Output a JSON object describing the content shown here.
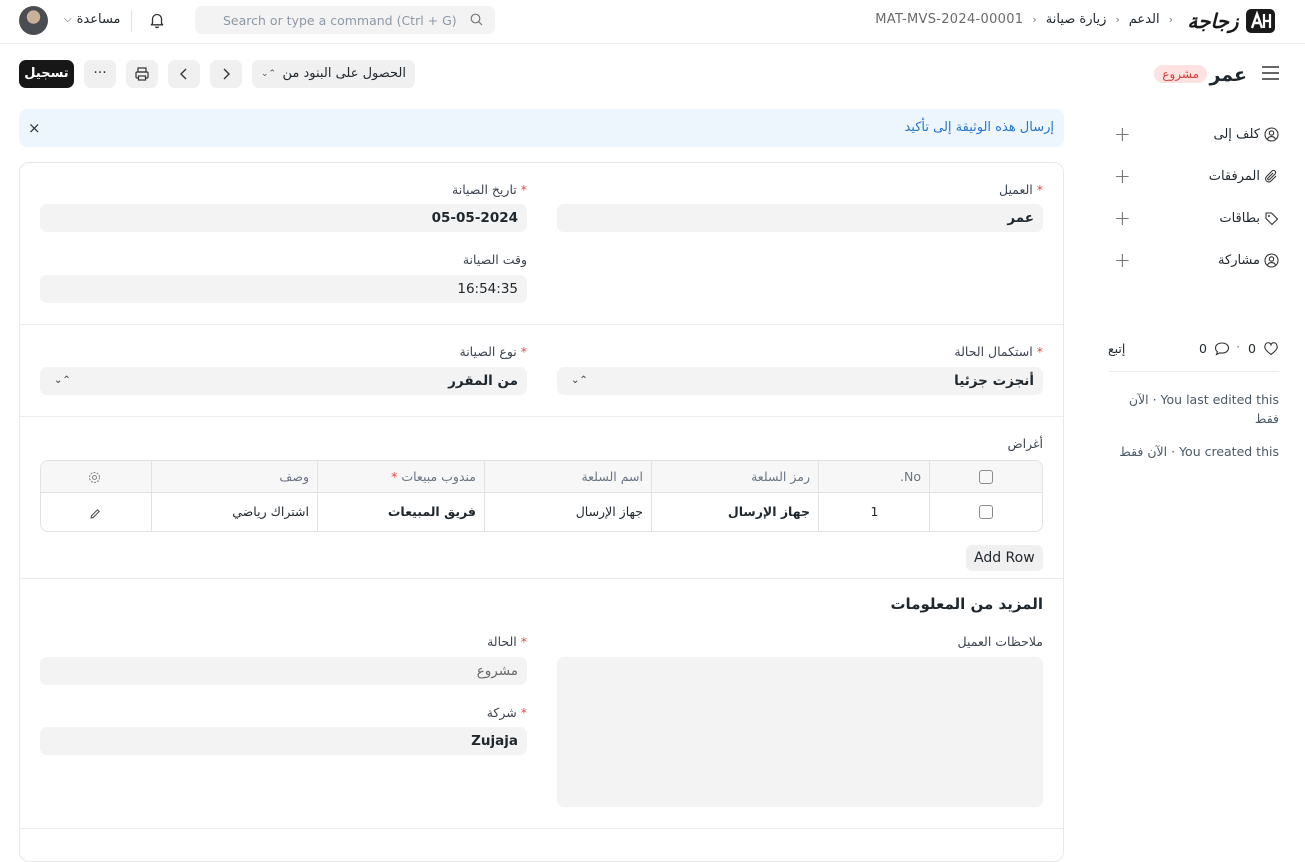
{
  "topbar": {
    "help_label": "مساعدة",
    "search_placeholder": "Search or type a command (Ctrl + G)",
    "breadcrumbs": [
      "الدعم",
      "زيارة صيانة",
      "MAT-MVS-2024-00001"
    ],
    "logo_text": "زجاجة"
  },
  "header": {
    "title": "عمر",
    "status_badge": "مشروع",
    "submit_label": "تسجيل",
    "more_label": "···",
    "get_items_label": "الحصول على البنود من"
  },
  "alert": {
    "message": "إرسال هذه الوثيقة إلى تأكيد",
    "close": "×"
  },
  "sidebar": {
    "items": [
      {
        "label": "كلف إلى",
        "icon": "assign-user-icon"
      },
      {
        "label": "المرفقات",
        "icon": "paperclip-icon"
      },
      {
        "label": "بطاقات",
        "icon": "tag-icon"
      },
      {
        "label": "مشاركة",
        "icon": "share-user-icon"
      }
    ],
    "likes": "0",
    "comments": "0",
    "follow_label": "إتبع",
    "activity": [
      "You last edited this · الآن فقط",
      "You created this · الآن فقط"
    ]
  },
  "form": {
    "customer": {
      "label": "العميل",
      "value": "عمر"
    },
    "maintenance_date": {
      "label": "تاريخ الصيانة",
      "value": "05-05-2024"
    },
    "maintenance_time": {
      "label": "وقت الصيانة",
      "value": "16:54:35"
    },
    "completion_status": {
      "label": "استكمال الحالة",
      "value": "أنجزت جزئيا"
    },
    "maintenance_type": {
      "label": "نوع الصيانة",
      "value": "من المقرر"
    },
    "purposes_label": "أغراض",
    "table": {
      "headers": [
        "No.",
        "رمز السلعة",
        "اسم السلعة",
        "مندوب مبيعات",
        "وصف"
      ],
      "rows": [
        {
          "no": "1",
          "item_code": "جهاز الإرسال",
          "item_name": "جهاز الإرسال",
          "sales_person": "فريق المبيعات",
          "description": "اشتراك رياضي"
        }
      ]
    },
    "add_row_label": "Add Row",
    "more_info_title": "المزيد من المعلومات",
    "customer_feedback": {
      "label": "ملاحظات العميل",
      "value": ""
    },
    "status": {
      "label": "الحالة",
      "value": "مشروع"
    },
    "company": {
      "label": "شركة",
      "value": "Zujaja"
    }
  },
  "colors": {
    "primary_button": "#171717",
    "badge_bg": "#fde2e1",
    "badge_text": "#d1423c",
    "alert_bg": "#edf6fd",
    "alert_text": "#2975cc",
    "required": "#e24c4c"
  }
}
